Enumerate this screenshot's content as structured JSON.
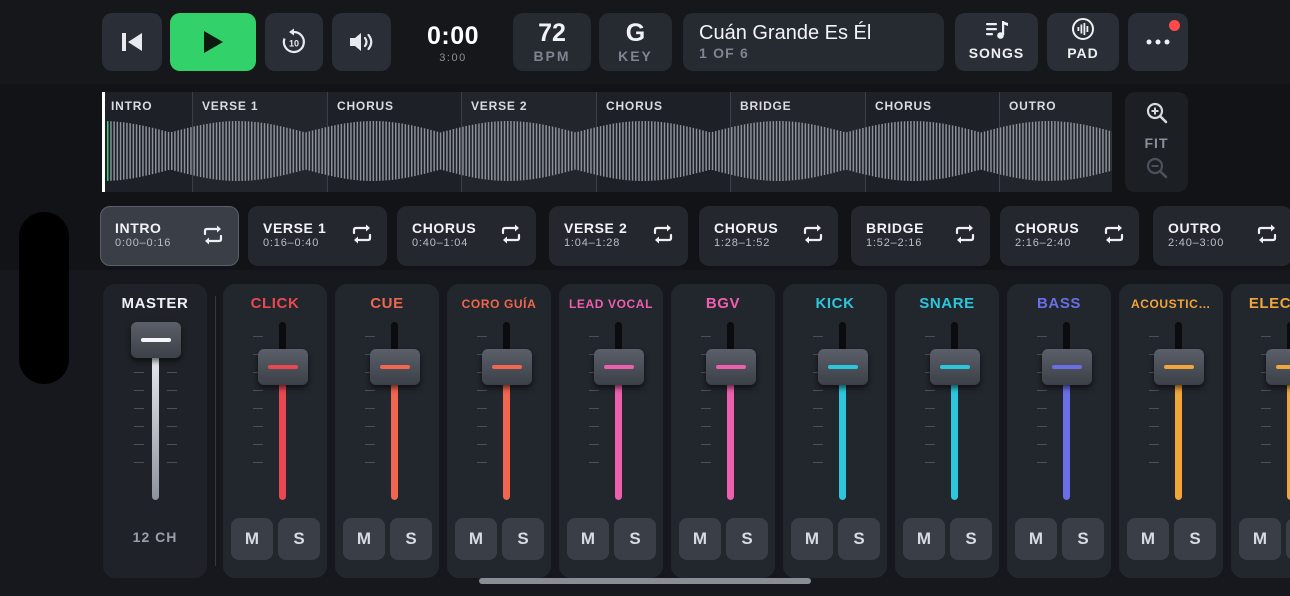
{
  "transport": {
    "time": "0:00",
    "duration": "3:00",
    "bpm_value": "72",
    "bpm_label": "BPM",
    "key_value": "G",
    "key_label": "KEY",
    "replay_amount": "10"
  },
  "song": {
    "title": "Cuán Grande Es Él",
    "position": "1 OF 6"
  },
  "nav": {
    "songs_label": "SONGS",
    "pad_label": "PAD"
  },
  "waveform": {
    "sections": [
      {
        "label": "INTRO"
      },
      {
        "label": "VERSE 1"
      },
      {
        "label": "CHORUS"
      },
      {
        "label": "VERSE 2"
      },
      {
        "label": "CHORUS"
      },
      {
        "label": "BRIDGE"
      },
      {
        "label": "CHORUS"
      },
      {
        "label": "OUTRO"
      }
    ],
    "zoom_fit_label": "FIT"
  },
  "sections": [
    {
      "name": "INTRO",
      "time": "0:00–0:16",
      "active": true
    },
    {
      "name": "VERSE 1",
      "time": "0:16–0:40",
      "active": false
    },
    {
      "name": "CHORUS",
      "time": "0:40–1:04",
      "active": false
    },
    {
      "name": "VERSE 2",
      "time": "1:04–1:28",
      "active": false
    },
    {
      "name": "CHORUS",
      "time": "1:28–1:52",
      "active": false
    },
    {
      "name": "BRIDGE",
      "time": "1:52–2:16",
      "active": false
    },
    {
      "name": "CHORUS",
      "time": "2:16–2:40",
      "active": false
    },
    {
      "name": "OUTRO",
      "time": "2:40–3:00",
      "active": false
    }
  ],
  "mixer": {
    "master": {
      "name": "MASTER",
      "info": "12 CH",
      "level": 0.9
    },
    "channels": [
      {
        "name": "CLICK",
        "color": "#e8484f",
        "level": 0.75,
        "mute": "M",
        "solo": "S"
      },
      {
        "name": "CUE",
        "color": "#f0664e",
        "level": 0.75,
        "mute": "M",
        "solo": "S"
      },
      {
        "name": "CORO GUÍA",
        "color": "#f0664e",
        "level": 0.75,
        "mute": "M",
        "solo": "S"
      },
      {
        "name": "LEAD VOCAL",
        "color": "#ee5fae",
        "level": 0.75,
        "mute": "M",
        "solo": "S"
      },
      {
        "name": "BGV",
        "color": "#ee5fae",
        "level": 0.75,
        "mute": "M",
        "solo": "S"
      },
      {
        "name": "KICK",
        "color": "#2ec6dd",
        "level": 0.75,
        "mute": "M",
        "solo": "S"
      },
      {
        "name": "SNARE",
        "color": "#2ec6dd",
        "level": 0.75,
        "mute": "M",
        "solo": "S"
      },
      {
        "name": "BASS",
        "color": "#6b6fe6",
        "level": 0.75,
        "mute": "M",
        "solo": "S"
      },
      {
        "name": "ACOUSTIC…",
        "color": "#f2a53a",
        "level": 0.75,
        "mute": "M",
        "solo": "S"
      },
      {
        "name": "ELECTRI",
        "color": "#f2a53a",
        "level": 0.75,
        "mute": "M",
        "solo": "S"
      }
    ]
  }
}
